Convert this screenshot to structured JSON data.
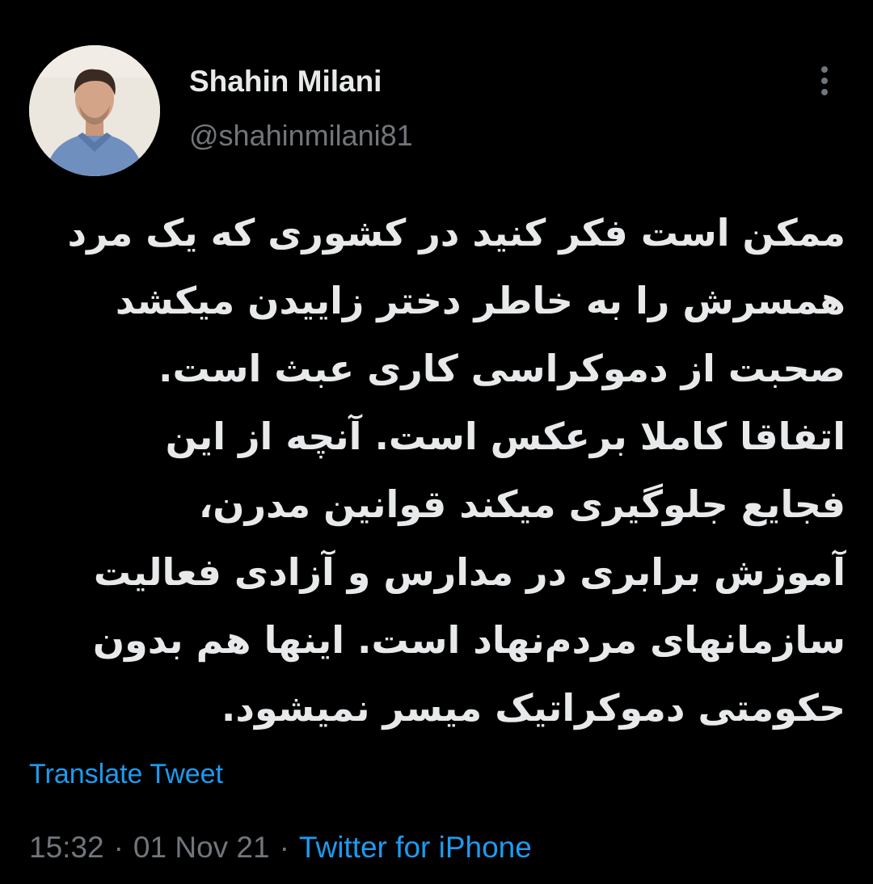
{
  "author": {
    "display_name": "Shahin Milani",
    "handle": "@shahinmilani81"
  },
  "tweet": {
    "lines": [
      "ممکن است فکر کنید در کشوری که یک مرد",
      "همسرش را به خاطر دختر زاییدن میکشد",
      "صحبت از دموکراسی کاری عبث است.",
      "اتفاقا کاملا برعکس است. آنچه از این",
      "فجایع جلوگیری میکند قوانین مدرن،",
      "آموزش برابری در مدارس و آزادی فعالیت",
      "سازمانهای مردم‌نهاد است. اینها هم بدون",
      "حکومتی دموکراتیک میسر نمیشود."
    ]
  },
  "actions": {
    "translate_label": "Translate Tweet"
  },
  "meta": {
    "time": "15:32",
    "separator": "·",
    "date": "01 Nov 21",
    "source": "Twitter for iPhone"
  },
  "icons": {
    "more": "more-vertical-icon"
  },
  "colors": {
    "background": "#000000",
    "text": "#e7e9ea",
    "secondary": "#71767b",
    "link": "#1d9bf0"
  }
}
